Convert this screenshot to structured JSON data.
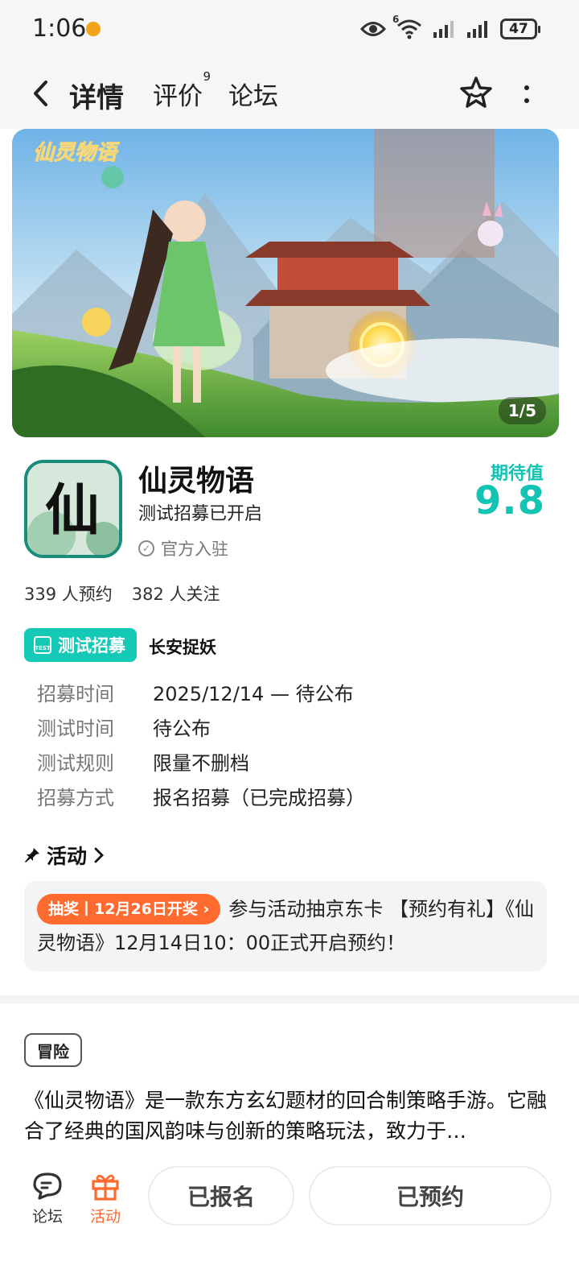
{
  "status_bar": {
    "time": "1:06",
    "battery": "47",
    "network_label": "6"
  },
  "header": {
    "tabs": [
      {
        "label": "详情",
        "active": true
      },
      {
        "label": "评价",
        "badge": "9"
      },
      {
        "label": "论坛"
      }
    ],
    "icons": [
      "back-icon",
      "favorite-star-icon",
      "more-icon"
    ]
  },
  "banner": {
    "counter": "1/5",
    "logo_text": "仙灵物语"
  },
  "game": {
    "icon_char": "仙",
    "title": "仙灵物语",
    "subtitle": "测试招募已开启",
    "official": "官方入驻",
    "expect_label": "期待值",
    "expect_score": "9.8",
    "reservations": "339 人预约",
    "followers": "382 人关注"
  },
  "recruit": {
    "badge": "测试招募",
    "badge_icon_text": "TEST",
    "name": "长安捉妖",
    "rows": [
      {
        "label": "招募时间",
        "value": "2025/12/14 — 待公布"
      },
      {
        "label": "测试时间",
        "value": "待公布"
      },
      {
        "label": "测试规则",
        "value": "限量不删档"
      },
      {
        "label": "招募方式",
        "value": "报名招募（已完成招募）"
      }
    ]
  },
  "activity": {
    "heading": "活动",
    "tag": "抽奖丨12月26日开奖",
    "text": "参与活动抽京东卡 【预约有礼】《仙灵物语》12月14日10：00正式开启预约！"
  },
  "intro": {
    "genre": "冒险",
    "description": "《仙灵物语》是一款东方玄幻题材的回合制策略手游。它融合了经典的国风韵味与创新的策略玩法，致力于…"
  },
  "bottom_bar": {
    "nav": [
      {
        "label": "论坛",
        "icon": "forum-icon"
      },
      {
        "label": "活动",
        "icon": "gift-icon"
      }
    ],
    "registered_button": "已报名",
    "reserved_button": "已预约"
  },
  "colors": {
    "accent": "#15c9b7",
    "orange": "#ff6a2f"
  }
}
